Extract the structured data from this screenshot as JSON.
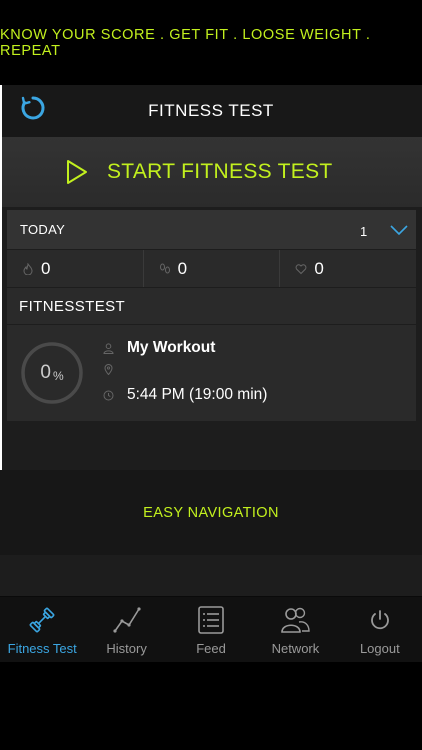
{
  "banner": {
    "text": "KNOW YOUR SCORE . GET FIT . LOOSE WEIGHT . REPEAT"
  },
  "header": {
    "title": "FITNESS TEST",
    "refresh_icon": "refresh-icon"
  },
  "start": {
    "label": "START FITNESS TEST",
    "icon": "play-icon"
  },
  "today": {
    "label": "TODAY",
    "count": "1",
    "stats": [
      {
        "icon": "flame-icon",
        "value": "0"
      },
      {
        "icon": "footsteps-icon",
        "value": "0"
      },
      {
        "icon": "heart-icon",
        "value": "0"
      }
    ]
  },
  "section": {
    "title": "FITNESSTEST"
  },
  "workout": {
    "progress_value": "0",
    "progress_unit": "%",
    "progress_fraction": 0,
    "name": "My Workout",
    "location": "",
    "time": "5:44 PM (19:00 min)"
  },
  "hint": {
    "text": "EASY NAVIGATION"
  },
  "tabs": [
    {
      "label": "Fitness Test",
      "icon": "dumbbell-icon",
      "active": true
    },
    {
      "label": "History",
      "icon": "line-graph-icon",
      "active": false
    },
    {
      "label": "Feed",
      "icon": "list-icon",
      "active": false
    },
    {
      "label": "Network",
      "icon": "people-icon",
      "active": false
    },
    {
      "label": "Logout",
      "icon": "power-icon",
      "active": false
    }
  ],
  "colors": {
    "accent": "#c2f01e",
    "active_tab": "#3ba6e2",
    "background": "#1d1d1d"
  }
}
